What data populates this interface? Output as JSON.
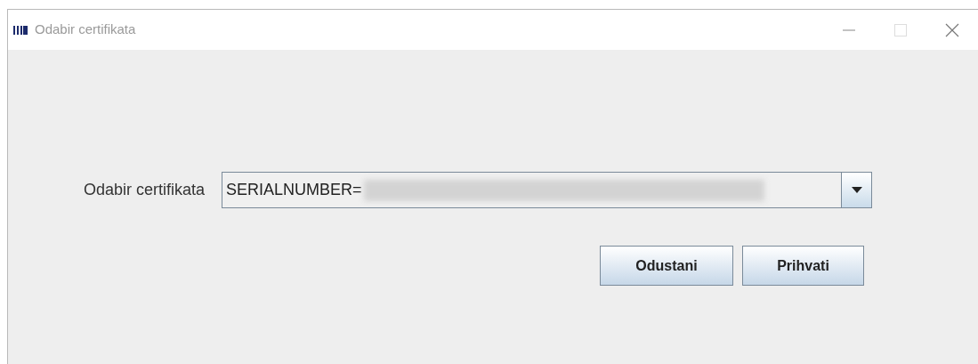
{
  "window": {
    "title": "Odabir certifikata"
  },
  "form": {
    "label": "Odabir certifikata",
    "combo_value": "SERIALNUMBER="
  },
  "buttons": [
    "Odustani",
    "Prihvati"
  ]
}
